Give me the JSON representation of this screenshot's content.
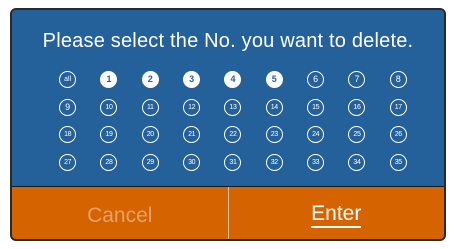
{
  "dialog": {
    "title": "Please select the No. you want to delete.",
    "numbers": [
      {
        "label": "all",
        "selected": false
      },
      {
        "label": "1",
        "selected": true
      },
      {
        "label": "2",
        "selected": true
      },
      {
        "label": "3",
        "selected": true
      },
      {
        "label": "4",
        "selected": true
      },
      {
        "label": "5",
        "selected": true
      },
      {
        "label": "6",
        "selected": false
      },
      {
        "label": "7",
        "selected": false
      },
      {
        "label": "8",
        "selected": false
      },
      {
        "label": "9",
        "selected": false
      },
      {
        "label": "10",
        "selected": false
      },
      {
        "label": "11",
        "selected": false
      },
      {
        "label": "12",
        "selected": false
      },
      {
        "label": "13",
        "selected": false
      },
      {
        "label": "14",
        "selected": false
      },
      {
        "label": "15",
        "selected": false
      },
      {
        "label": "16",
        "selected": false
      },
      {
        "label": "17",
        "selected": false
      },
      {
        "label": "18",
        "selected": false
      },
      {
        "label": "19",
        "selected": false
      },
      {
        "label": "20",
        "selected": false
      },
      {
        "label": "21",
        "selected": false
      },
      {
        "label": "22",
        "selected": false
      },
      {
        "label": "23",
        "selected": false
      },
      {
        "label": "24",
        "selected": false
      },
      {
        "label": "25",
        "selected": false
      },
      {
        "label": "26",
        "selected": false
      },
      {
        "label": "27",
        "selected": false
      },
      {
        "label": "28",
        "selected": false
      },
      {
        "label": "29",
        "selected": false
      },
      {
        "label": "30",
        "selected": false
      },
      {
        "label": "31",
        "selected": false
      },
      {
        "label": "32",
        "selected": false
      },
      {
        "label": "33",
        "selected": false
      },
      {
        "label": "34",
        "selected": false
      },
      {
        "label": "35",
        "selected": false
      }
    ],
    "cancel_label": "Cancel",
    "enter_label": "Enter"
  },
  "colors": {
    "panel": "#24609a",
    "footer": "#d46300",
    "cancel_text": "#e9a168",
    "enter_text": "#ffffff"
  }
}
